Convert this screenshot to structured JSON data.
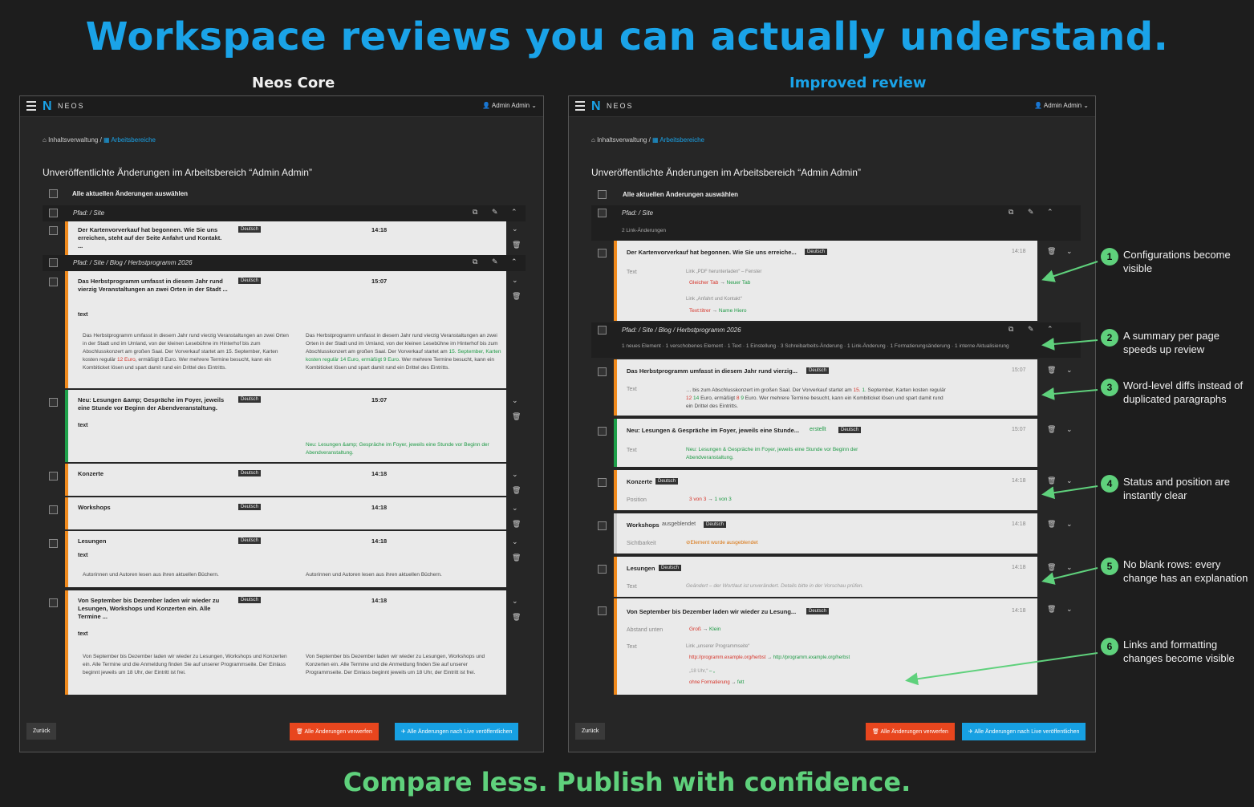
{
  "headline": "Workspace reviews you can actually understand.",
  "tagline": "Compare less. Publish with confidence.",
  "left_title": "Neos Core",
  "right_title": "Improved review",
  "colors": {
    "accent_blue": "#1aa3e8",
    "accent_green": "#5fd17c",
    "orange": "#f08a1d",
    "red_button": "#e8461e",
    "blue_button": "#17a0e2"
  },
  "app": {
    "brand": "NEOS",
    "user": "Admin Admin",
    "breadcrumb_home": "Inhaltsverwaltung",
    "breadcrumb_sep": "/",
    "breadcrumb_current": "Arbeitsbereiche",
    "heading": "Unveröffentlichte Änderungen im Arbeitsbereich “Admin Admin”",
    "select_all": "Alle aktuellen Änderungen auswählen",
    "back": "Zurück",
    "discard_all": "Alle Änderungen verwerfen",
    "publish_all": "Alle Änderungen nach Live veröffentlichen"
  },
  "left": {
    "path1": "Pfad: / Site",
    "path2": "Pfad: / Site / Blog / Herbstprogramm 2026",
    "lang": "Deutsch",
    "text_label": "text",
    "c1": {
      "title": "Der Kartenvorverkauf hat begonnen. Wie Sie uns erreichen, steht auf der Seite Anfahrt und Kontakt. ...",
      "time": "14:18"
    },
    "c2": {
      "title": "Das Herbstprogramm umfasst in diesem Jahr rund vierzig Veranstaltungen an zwei Orten in der Stadt ...",
      "time": "15:07",
      "old_a": "Das Herbstprogramm umfasst in diesem Jahr rund vierzig Veranstaltungen an zwei Orten in der Stadt und im Umland, von der kleinen Lesebühne im Hinterhof bis zum Abschlusskonzert am großen Saal. Der Vorverkauf startet am 15. September, Karten kosten regulär",
      "old_red": "12 Euro",
      "old_b": ", ermäßigt 8 Euro. Wer mehrere Termine besucht, kann ein Kombiticket lösen und spart damit rund ein Drittel des Eintritts.",
      "new_a": "Das Herbstprogramm umfasst in diesem Jahr rund vierzig Veranstaltungen an zwei Orten in der Stadt und im Umland, von der kleinen Lesebühne im Hinterhof bis zum Abschlusskonzert am großen Saal. Der Vorverkauf startet am",
      "new_grn": "15. September, Karten kosten regulär 14 Euro, ermäßigt 9 Euro",
      "new_b": ". Wer mehrere Termine besucht, kann ein Kombiticket lösen und spart damit rund ein Drittel des Eintritts."
    },
    "c3": {
      "title": "Neu: Lesungen &amp; Gespräche im Foyer, jeweils eine Stunde vor Beginn der Abendveranstaltung.",
      "time": "15:07",
      "new": "Neu: Lesungen &amp; Gespräche im Foyer, jeweils eine Stunde vor Beginn der Abendveranstaltung."
    },
    "c4": {
      "title": "Konzerte",
      "time": "14:18"
    },
    "c5": {
      "title": "Workshops",
      "time": "14:18"
    },
    "c6": {
      "title": "Lesungen",
      "time": "14:18",
      "old": "Autorinnen und Autoren lesen aus ihren aktuellen Büchern.",
      "new": "Autorinnen und Autoren lesen aus ihren aktuellen Büchern."
    },
    "c7": {
      "title": "Von September bis Dezember laden wir wieder zu Lesungen, Workshops und Konzerten ein. Alle Termine ...",
      "time": "14:18",
      "old": "Von September bis Dezember laden wir wieder zu Lesungen, Workshops und Konzerten ein. Alle Termine und die Anmeldung finden Sie auf unserer Programmseite. Der Einlass beginnt jeweils um 18 Uhr, der Eintritt ist frei.",
      "new": "Von September bis Dezember laden wir wieder zu Lesungen, Workshops und Konzerten ein. Alle Termine und die Anmeldung finden Sie auf unserer Programmseite. Der Einlass beginnt jeweils um 18 Uhr, der Eintritt ist frei."
    }
  },
  "right": {
    "path1": "Pfad: / Site",
    "sum1": "2 Link-Änderungen",
    "path2": "Pfad: / Site / Blog / Herbstprogramm 2026",
    "sum2": "1 neues Element · 1 verschobenes Element · 1 Text · 1 Einstellung · 3 Schreibarbeits-Änderung · 1 Link-Änderung · 1 Formatierungsänderung · 1 interne Aktualisierung",
    "lang": "Deutsch",
    "arrow": "→",
    "c1": {
      "title": "Der Kartenvorverkauf hat begonnen. Wie Sie uns erreiche...",
      "time": "14:18",
      "field": "Text",
      "l1": "Link „PDF herunterladen“ – Fenster",
      "l1_old": "Gleicher Tab",
      "l1_new": "Neuer Tab",
      "l2": "Link „Anfahrt und Kontakt“",
      "l2_old": "Text:titrer",
      "l2_new": "Name Hiero"
    },
    "c2": {
      "title": "Das Herbstprogramm umfasst in diesem Jahr rund vierzig...",
      "time": "15:07",
      "field": "Text",
      "d1": "… bis zum Abschlusskonzert im großen Saal. Der Vorverkauf startet am",
      "r1": "15.",
      "g1": "1.",
      "d2": "September,",
      "d3": "Karten kosten regulär",
      "r2": "12",
      "g2": "14",
      "d4": "Euro, ermäßigt",
      "r3": "8",
      "g3": "9",
      "d5": "Euro. Wer mehrere Termine besucht, kann",
      "d6": "ein Kombiticket lösen und spart damit rund ein Drittel des Eintritts."
    },
    "c3": {
      "title": "Neu: Lesungen & Gespräche im Foyer, jeweils eine Stunde...",
      "status": "erstellt",
      "time": "15:07",
      "field": "Text",
      "new": "Neu: Lesungen & Gespräche im Foyer, jeweils eine Stunde vor Beginn der Abendveranstaltung."
    },
    "c4": {
      "title": "Konzerte",
      "time": "14:18",
      "field": "Position",
      "old": "3 von 3",
      "new": "1 von 3"
    },
    "c5": {
      "title": "Workshops",
      "status": "ausgeblendet",
      "time": "14:18",
      "field": "Sichtbarkeit",
      "note": "Element wurde ausgeblendet"
    },
    "c6": {
      "title": "Lesungen",
      "time": "14:18",
      "field": "Text",
      "note": "Geändert – der Wortlaut ist unverändert. Details bitte in der Vorschau prüfen."
    },
    "c7": {
      "title": "Von September bis Dezember laden wir wieder zu Lesung...",
      "time": "14:18",
      "f1": "Abstand unten",
      "f1_old": "Groß",
      "f1_new": "Klein",
      "f2": "Text",
      "l": "Link „unserer Programmseite“",
      "l_old": "http://programm.example.org/herbst",
      "l_new": "http://programm.example.org/herbst",
      "q_old": "„18 Uhr,“",
      "q_new": "– „",
      "fmt_old": "ohne Formatierung",
      "fmt_new": "fett"
    }
  },
  "annotations": [
    {
      "n": "1",
      "text": "Configurations become visible"
    },
    {
      "n": "2",
      "text": "A summary per page speeds up review"
    },
    {
      "n": "3",
      "text": "Word-level diffs instead of duplicated paragraphs"
    },
    {
      "n": "4",
      "text": "Status and position are instantly clear"
    },
    {
      "n": "5",
      "text": "No blank rows: every change has an explanation"
    },
    {
      "n": "6",
      "text": "Links and formatting changes become visible"
    }
  ]
}
